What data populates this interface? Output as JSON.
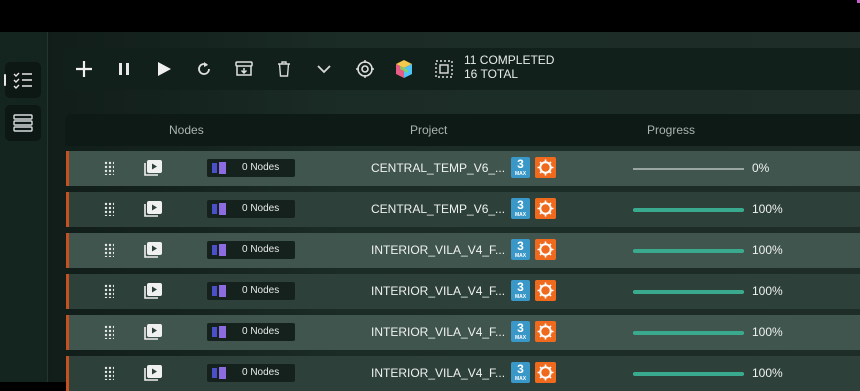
{
  "toolbar": {
    "status_completed": "11 COMPLETED",
    "status_total": "16 TOTAL",
    "icons": [
      "plus-icon",
      "pause-icon",
      "play-icon",
      "refresh-icon",
      "archive-icon",
      "trash-icon",
      "chevron-down-icon",
      "target-icon",
      "cube-stack-icon",
      "select-all-icon"
    ]
  },
  "table": {
    "headers": {
      "nodes": "Nodes",
      "project": "Project",
      "progress": "Progress"
    },
    "rows": [
      {
        "nodes": "0 Nodes",
        "project": "CENTRAL_TEMP_V6_...",
        "progress_text": "0%",
        "progress": 0
      },
      {
        "nodes": "0 Nodes",
        "project": "CENTRAL_TEMP_V6_...",
        "progress_text": "100%",
        "progress": 1
      },
      {
        "nodes": "0 Nodes",
        "project": "INTERIOR_VILA_V4_F...",
        "progress_text": "100%",
        "progress": 1
      },
      {
        "nodes": "0 Nodes",
        "project": "INTERIOR_VILA_V4_F...",
        "progress_text": "100%",
        "progress": 1
      },
      {
        "nodes": "0 Nodes",
        "project": "INTERIOR_VILA_V4_F...",
        "progress_text": "100%",
        "progress": 1
      },
      {
        "nodes": "0 Nodes",
        "project": "INTERIOR_VILA_V4_F...",
        "progress_text": "100%",
        "progress": 1
      }
    ]
  },
  "colors": {
    "accent_row_border": "#c4511f",
    "progress_fill": "#3aaa8e",
    "max_blue": "#3a98c9",
    "corona_orange": "#ef6a1c"
  },
  "max_icon": {
    "digit": "3",
    "sub": "MAX"
  }
}
